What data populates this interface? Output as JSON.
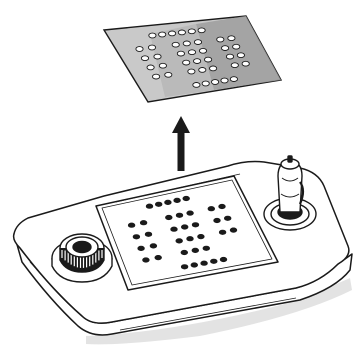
{
  "figure": {
    "description": "",
    "colors": {
      "ink": "#1a1a1a",
      "overlay_fill": "#c8c8c8",
      "overlay_shade": "#9a9a9a",
      "body_fill": "#ffffff",
      "shadow": "#d9d9d9"
    },
    "components": {
      "overlay": "keypad-overlay-sheet",
      "arrow": "lift-up-arrow",
      "console": "ptz-keyboard-console",
      "left_control": "jog-shuttle-wheel",
      "right_control": "joystick"
    }
  }
}
